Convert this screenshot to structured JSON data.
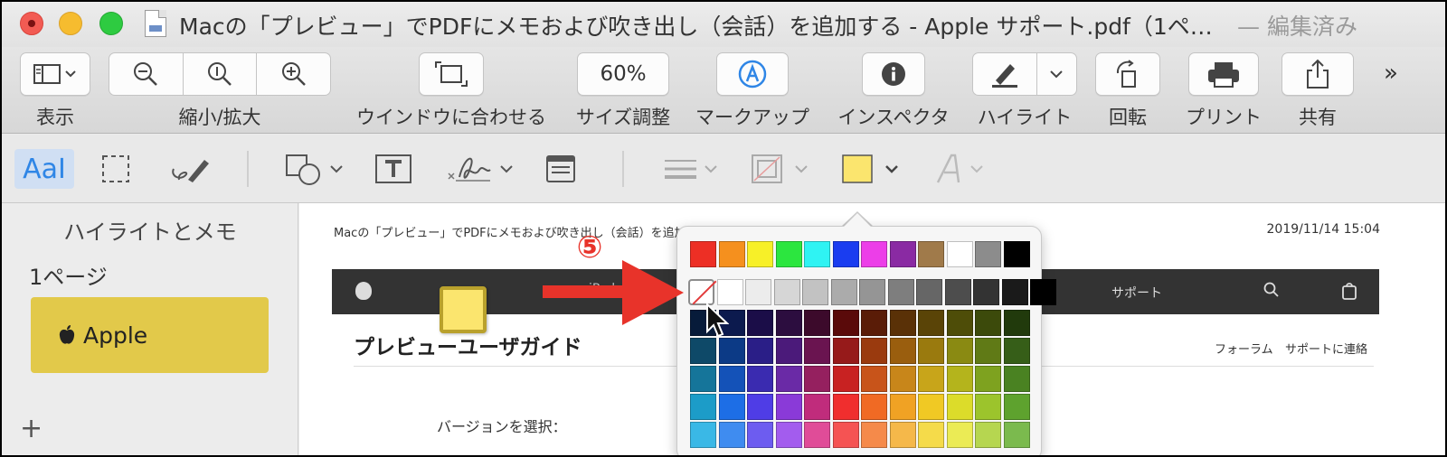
{
  "window": {
    "title": "Macの「プレビュー」でPDFにメモおよび吹き出し（会話）を追加する - Apple サポート.pdf（1ペ…",
    "edited_status": "— 編集済み"
  },
  "toolbar": {
    "view_label": "表示",
    "zoom_label": "縮小/拡大",
    "fit_label": "ウインドウに合わせる",
    "zoom_value": "60%",
    "size_label": "サイズ調整",
    "markup_label": "マークアップ",
    "inspector_label": "インスペクタ",
    "highlight_label": "ハイライト",
    "rotate_label": "回転",
    "print_label": "プリント",
    "share_label": "共有",
    "more_glyph": "»"
  },
  "markup_toolbar": {
    "text_selection_glyph": "Aa",
    "icons": [
      "text-selection-icon",
      "rect-selection-icon",
      "sketch-icon",
      "shapes-icon",
      "text-box-icon",
      "signature-icon",
      "note-icon",
      "line-style-icon",
      "border-color-icon",
      "fill-color-icon",
      "text-style-icon"
    ]
  },
  "sidebar": {
    "title": "ハイライトとメモ",
    "page_label": "1ページ",
    "note_text": "Apple",
    "add_glyph": "+"
  },
  "document": {
    "header_text": "Macの「プレビュー」でPDFにメモおよび吹き出し（会話）を追加する - Apple サポート",
    "date": "2019/11/14 15:04",
    "nav_ipad": "iPad",
    "nav_support": "サポート",
    "guide_title": "プレビューユーザガイド",
    "forum_link": "フォーラム",
    "contact_link": "サポートに連絡",
    "version_label": "バージョンを選択："
  },
  "annotation": {
    "step_number": "⑤",
    "arrow_color": "#e8332a"
  },
  "color_palette": {
    "row1": [
      "#ed2f25",
      "#f5901e",
      "#f7f028",
      "#2ce63f",
      "#2ff3f3",
      "#1a3df0",
      "#ec3ee8",
      "#8a2aa3",
      "#a07a4a",
      "#ffffff",
      "#8c8c8c",
      "#000000"
    ],
    "grays": [
      "none",
      "#ffffff",
      "#ececec",
      "#d6d6d6",
      "#c2c2c2",
      "#ababab",
      "#959595",
      "#7e7e7e",
      "#666666",
      "#4d4d4d",
      "#333333",
      "#1a1a1a",
      "#000000"
    ],
    "row3": [
      "#071b3a",
      "#0c1a4e",
      "#1b0d48",
      "#2c0d3f",
      "#3c0a2b",
      "#5a0a0a",
      "#5a1c07",
      "#5a3107",
      "#5a4407",
      "#4e4d08",
      "#3c4a0b",
      "#213a0c"
    ],
    "row4": [
      "#0e4968",
      "#0c3a86",
      "#2a1e87",
      "#4b1a7a",
      "#6a1450",
      "#961a1a",
      "#9a3a0e",
      "#9a5e0e",
      "#9a7a0e",
      "#8a8a12",
      "#607a16",
      "#365e18"
    ],
    "row5": [
      "#15759a",
      "#1452b8",
      "#3a2bb0",
      "#6a2aa6",
      "#95205f",
      "#c82222",
      "#c8541a",
      "#c8861a",
      "#c8a51a",
      "#b4b41c",
      "#7ea21f",
      "#4a8222"
    ],
    "row6": [
      "#1c9cc8",
      "#1d6ee6",
      "#4f3de6",
      "#8a3ad8",
      "#c02c7c",
      "#f02e2e",
      "#f06a24",
      "#f0a224",
      "#f0c924",
      "#dcdc2a",
      "#9cc42c",
      "#5ea22e"
    ],
    "row7": [
      "#3ab8e6",
      "#3f8cf0",
      "#6d5cf0",
      "#a35cee",
      "#e04c98",
      "#f55353",
      "#f58a4a",
      "#f5b84a",
      "#f5db4a",
      "#ebeb55",
      "#b6d650",
      "#7bba4e"
    ]
  }
}
